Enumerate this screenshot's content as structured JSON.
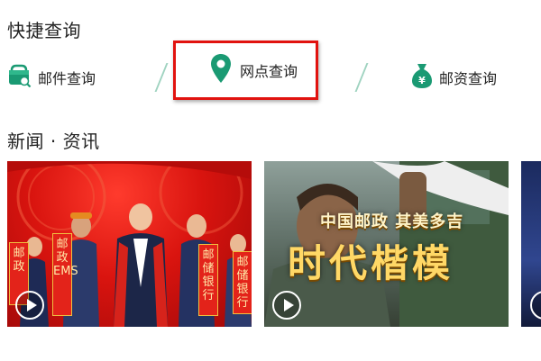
{
  "quick_query": {
    "title": "快捷查询",
    "items": [
      {
        "label": "邮件查询",
        "icon": "mail-package-icon"
      },
      {
        "label": "网点查询",
        "icon": "location-pin-icon",
        "highlighted": true
      },
      {
        "label": "邮资查询",
        "icon": "money-bag-icon"
      }
    ]
  },
  "news": {
    "title": "新闻 · 资讯",
    "cards": [
      {
        "scroll_texts": [
          "邮储银行",
          "邮政EMS",
          "邮储银行",
          "邮政"
        ]
      },
      {
        "subtitle": "中国邮政 其美多吉",
        "headline": "时代楷模"
      },
      {}
    ]
  },
  "colors": {
    "accent_green": "#1a9a73",
    "highlight_red": "#e1120f",
    "divider_green": "#9fd3c0"
  }
}
